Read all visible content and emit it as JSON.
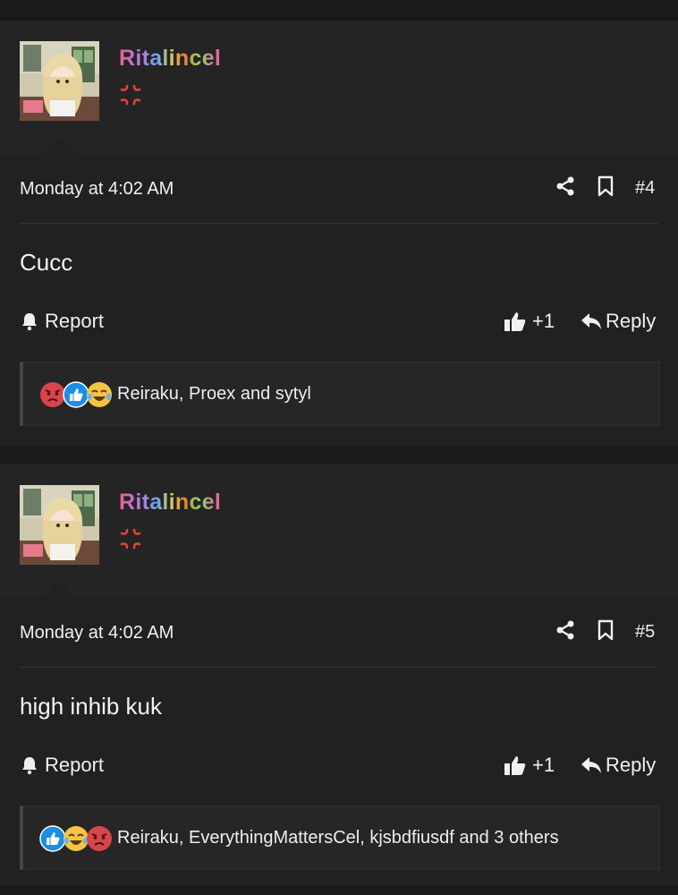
{
  "posts": [
    {
      "username": "Ritalincel",
      "date": "Monday at 4:02 AM",
      "number": "#4",
      "body": "Cucc",
      "report_label": "Report",
      "like_count": "+1",
      "reply_label": "Reply",
      "reactions_icons": [
        "angry-face-icon",
        "like-icon",
        "crying-laughing-icon"
      ],
      "reactions_text": "Reiraku, Proex and sytyl"
    },
    {
      "username": "Ritalincel",
      "date": "Monday at 4:02 AM",
      "number": "#5",
      "body": "high inhib kuk",
      "report_label": "Report",
      "like_count": "+1",
      "reply_label": "Reply",
      "reactions_icons": [
        "like-icon",
        "crying-laughing-icon",
        "angry-face-icon"
      ],
      "reactions_text": "Reiraku, EverythingMattersCel, kjsbdfiusdf and 3 others"
    }
  ],
  "colors": {
    "background": "#1a1a1a",
    "post_background": "#212121",
    "header_background": "#242424",
    "anger_icon": "#e0453a",
    "like_blue": "#1b8fe6",
    "angry_red": "#d9454a"
  }
}
